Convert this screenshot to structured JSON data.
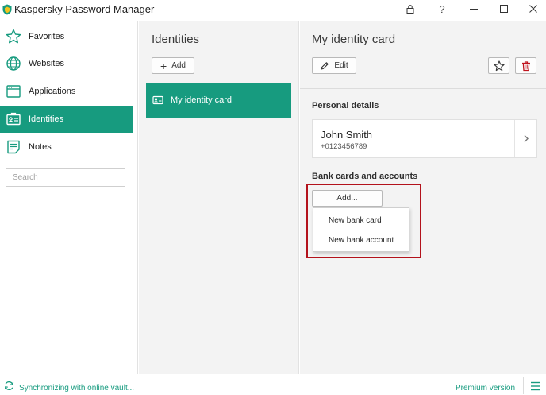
{
  "window": {
    "title": "Kaspersky Password Manager",
    "help_label": "?"
  },
  "sidebar": {
    "items": [
      {
        "label": "Favorites",
        "icon": "star-outline-icon"
      },
      {
        "label": "Websites",
        "icon": "globe-icon"
      },
      {
        "label": "Applications",
        "icon": "application-window-icon"
      },
      {
        "label": "Identities",
        "icon": "id-card-icon",
        "active": true
      },
      {
        "label": "Notes",
        "icon": "notes-icon"
      }
    ],
    "search_placeholder": "Search"
  },
  "middle": {
    "title": "Identities",
    "add_label": "Add",
    "items": [
      {
        "label": "My identity card",
        "selected": true
      }
    ]
  },
  "detail": {
    "title": "My identity card",
    "edit_label": "Edit",
    "personal_section": "Personal details",
    "person": {
      "name": "John Smith",
      "phone": "+0123456789"
    },
    "bank_section": "Bank cards and accounts",
    "bank_add_label": "Add...",
    "dropdown": [
      "New bank card",
      "New bank account"
    ]
  },
  "status": {
    "sync_text": "Synchronizing with online vault...",
    "premium_text": "Premium version"
  },
  "colors": {
    "accent": "#179b7f",
    "delete": "#c0141e",
    "highlight": "#b3121b"
  }
}
